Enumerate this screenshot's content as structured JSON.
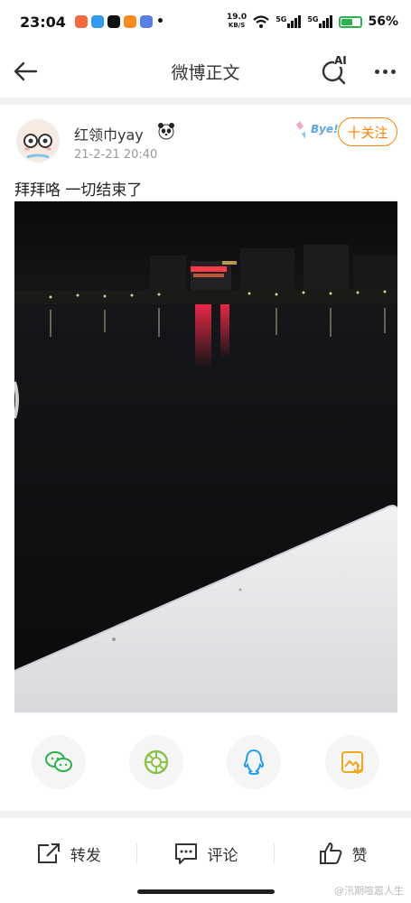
{
  "status_bar": {
    "time": "23:04",
    "net_speed_value": "19.0",
    "net_speed_unit": "KB/S",
    "signal_1": "5G",
    "signal_2": "5G",
    "battery": "56%"
  },
  "nav": {
    "title": "微博正文",
    "ai_label": "AI"
  },
  "post": {
    "username": "红领巾yay",
    "time": "21-2-21 20:40",
    "follow_label": "十关注",
    "badge_text": "Bye!",
    "text": "拜拜咯  一切结束了"
  },
  "share_targets": [
    "wechat-icon",
    "moments-icon",
    "qq-icon",
    "save-image-icon"
  ],
  "actions": {
    "repost_label": "转发",
    "comment_label": "评论",
    "like_label": "赞"
  },
  "watermark": "@汛期喧嚣人生",
  "colors": {
    "accent": "#ff8200",
    "wechat": "#2ab34a",
    "qq": "#1ea0e6",
    "save": "#f0a71a"
  }
}
